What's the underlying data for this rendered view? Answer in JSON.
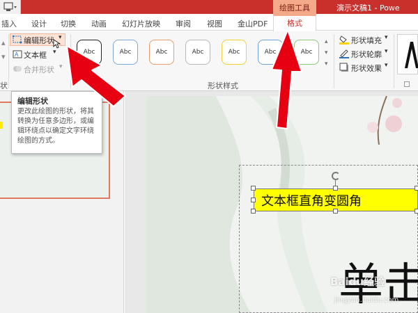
{
  "window": {
    "contextual_group": "绘图工具",
    "doc_title": "演示文稿1 - Powe"
  },
  "tabs": [
    {
      "label": "插入"
    },
    {
      "label": "设计"
    },
    {
      "label": "切换"
    },
    {
      "label": "动画"
    },
    {
      "label": "幻灯片放映"
    },
    {
      "label": "审阅"
    },
    {
      "label": "视图"
    },
    {
      "label": "金山PDF"
    }
  ],
  "active_tab": "格式",
  "ribbon": {
    "edit_shape": "编辑形状",
    "text_box": "文本框",
    "merge_shapes": "合并形状",
    "left_group_fragment": "状",
    "style_swatches": [
      "Abc",
      "Abc",
      "Abc",
      "Abc",
      "Abc",
      "Abc",
      "Abc"
    ],
    "style_group_label": "形状样式",
    "shape_fill": "形状填充",
    "shape_outline": "形状轮廓",
    "shape_effects": "形状效果"
  },
  "tooltip": {
    "title": "编辑形状",
    "body": "更改此绘图的形状，将其转换为任意多边形，或编辑环绕点以确定文字环绕绘图的方式。"
  },
  "slide": {
    "textbox_text": "文本框直角变圆角",
    "title_text": "单击",
    "watermark": "Baidu经验",
    "watermark_url": "jingyan.baidu.com"
  },
  "colors": {
    "titlebar": "#c9302c",
    "contextual": "#f4aa8a",
    "highlight": "#ffff00",
    "annotation_arrow": "#e60012"
  }
}
